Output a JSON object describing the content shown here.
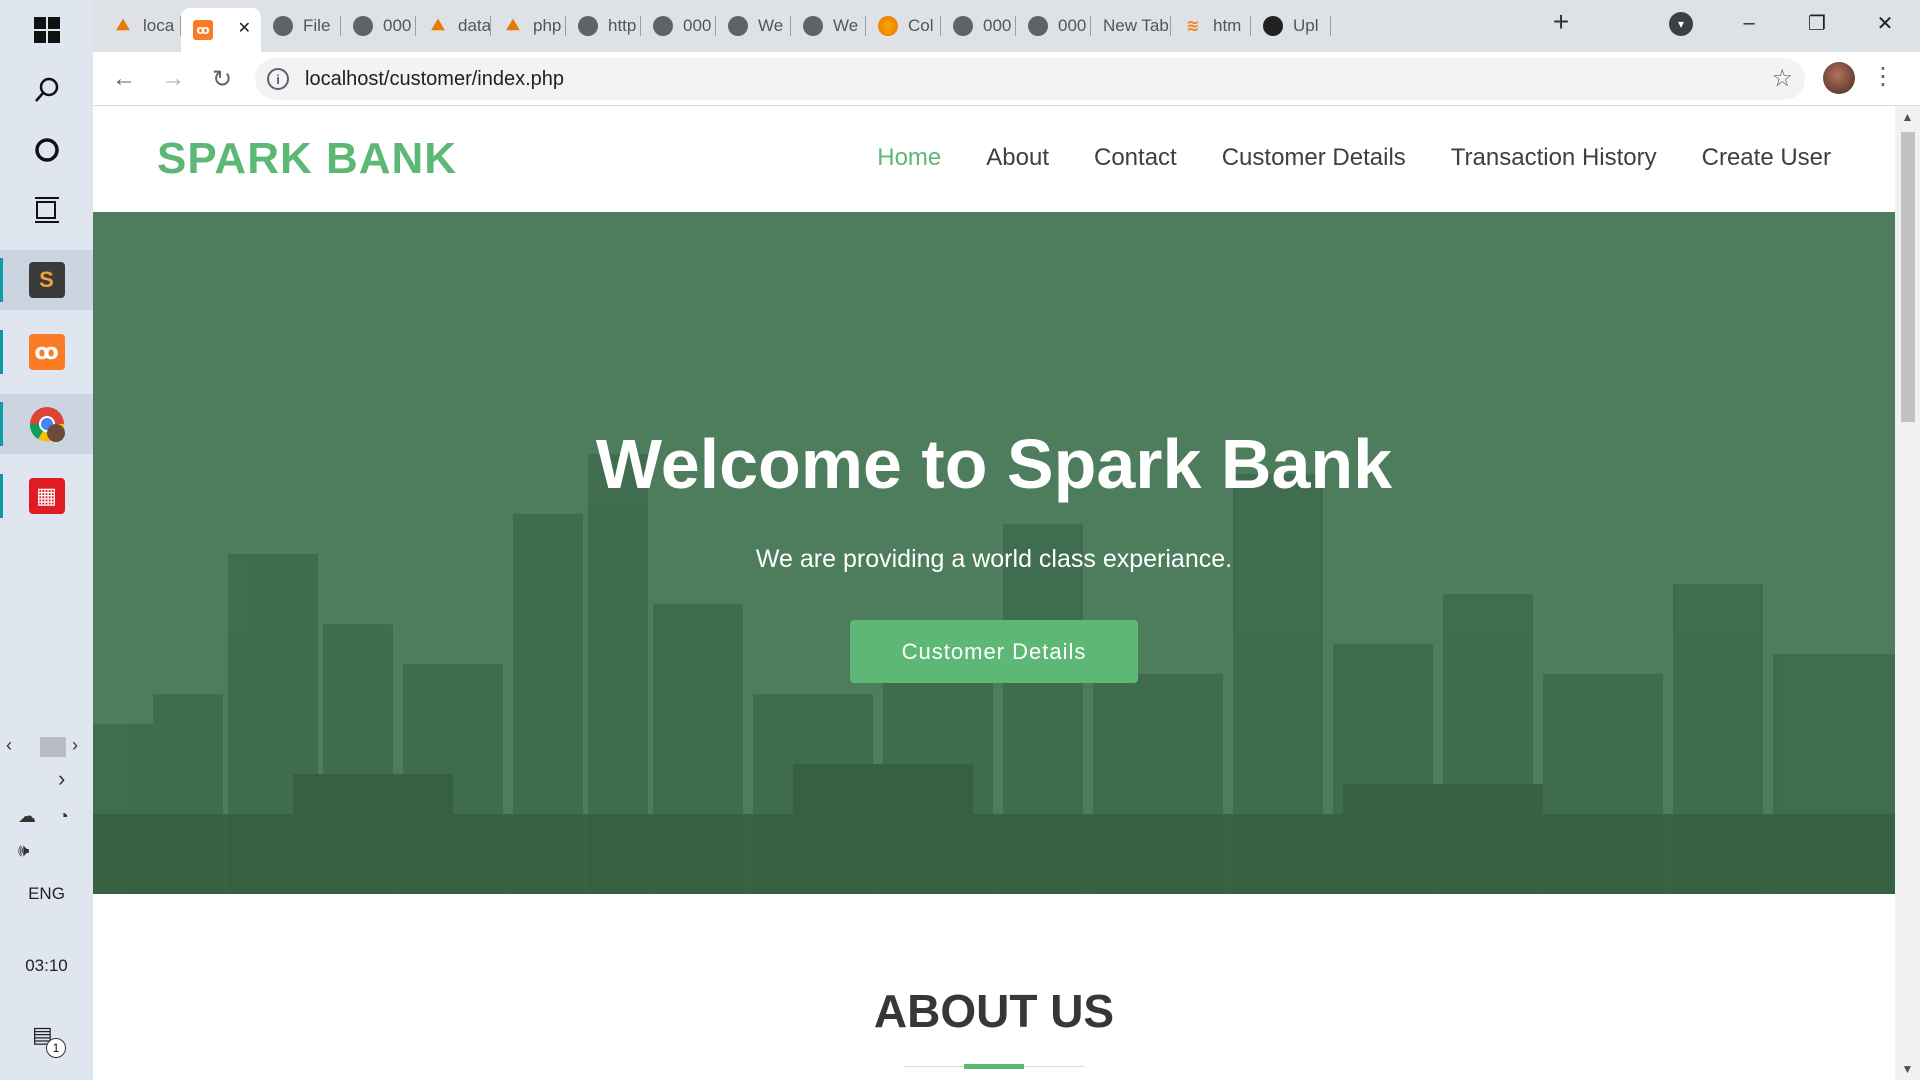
{
  "taskbar": {
    "start_icon": "windows-logo-icon",
    "tray": {
      "language": "ENG",
      "time": "03:10",
      "notification_count": "1"
    }
  },
  "browser": {
    "tabs": [
      {
        "label": "loca",
        "icon": "phpmyadmin-icon"
      },
      {
        "label": "",
        "icon": "xampp-icon",
        "active": true
      },
      {
        "label": "File",
        "icon": "globe-icon"
      },
      {
        "label": "000",
        "icon": "globe-icon"
      },
      {
        "label": "data",
        "icon": "phpmyadmin-icon"
      },
      {
        "label": "php",
        "icon": "phpmyadmin-icon"
      },
      {
        "label": "http",
        "icon": "globe-icon"
      },
      {
        "label": "000",
        "icon": "globe-icon"
      },
      {
        "label": "We",
        "icon": "globe-icon"
      },
      {
        "label": "We",
        "icon": "globe-icon"
      },
      {
        "label": "Col",
        "icon": "colab-icon"
      },
      {
        "label": "000",
        "icon": "globe-icon"
      },
      {
        "label": "000",
        "icon": "globe-icon"
      },
      {
        "label": "New Tab",
        "icon": ""
      },
      {
        "label": "htm",
        "icon": "stackoverflow-icon"
      },
      {
        "label": "Upl",
        "icon": "github-icon"
      }
    ],
    "new_tab_symbol": "+",
    "url": "localhost/customer/index.php"
  },
  "site": {
    "brand": "SPARK BANK",
    "nav": [
      "Home",
      "About",
      "Contact",
      "Customer Details",
      "Transaction History",
      "Create User"
    ],
    "active_nav": "Home",
    "hero": {
      "title": "Welcome to Spark Bank",
      "subtitle": "We are providing a world class experiance.",
      "button": "Customer Details"
    },
    "about_title": "ABOUT US"
  },
  "colors": {
    "accent": "#5cb874",
    "hero_overlay": "#4d7d5d",
    "text_dark": "#373737"
  }
}
